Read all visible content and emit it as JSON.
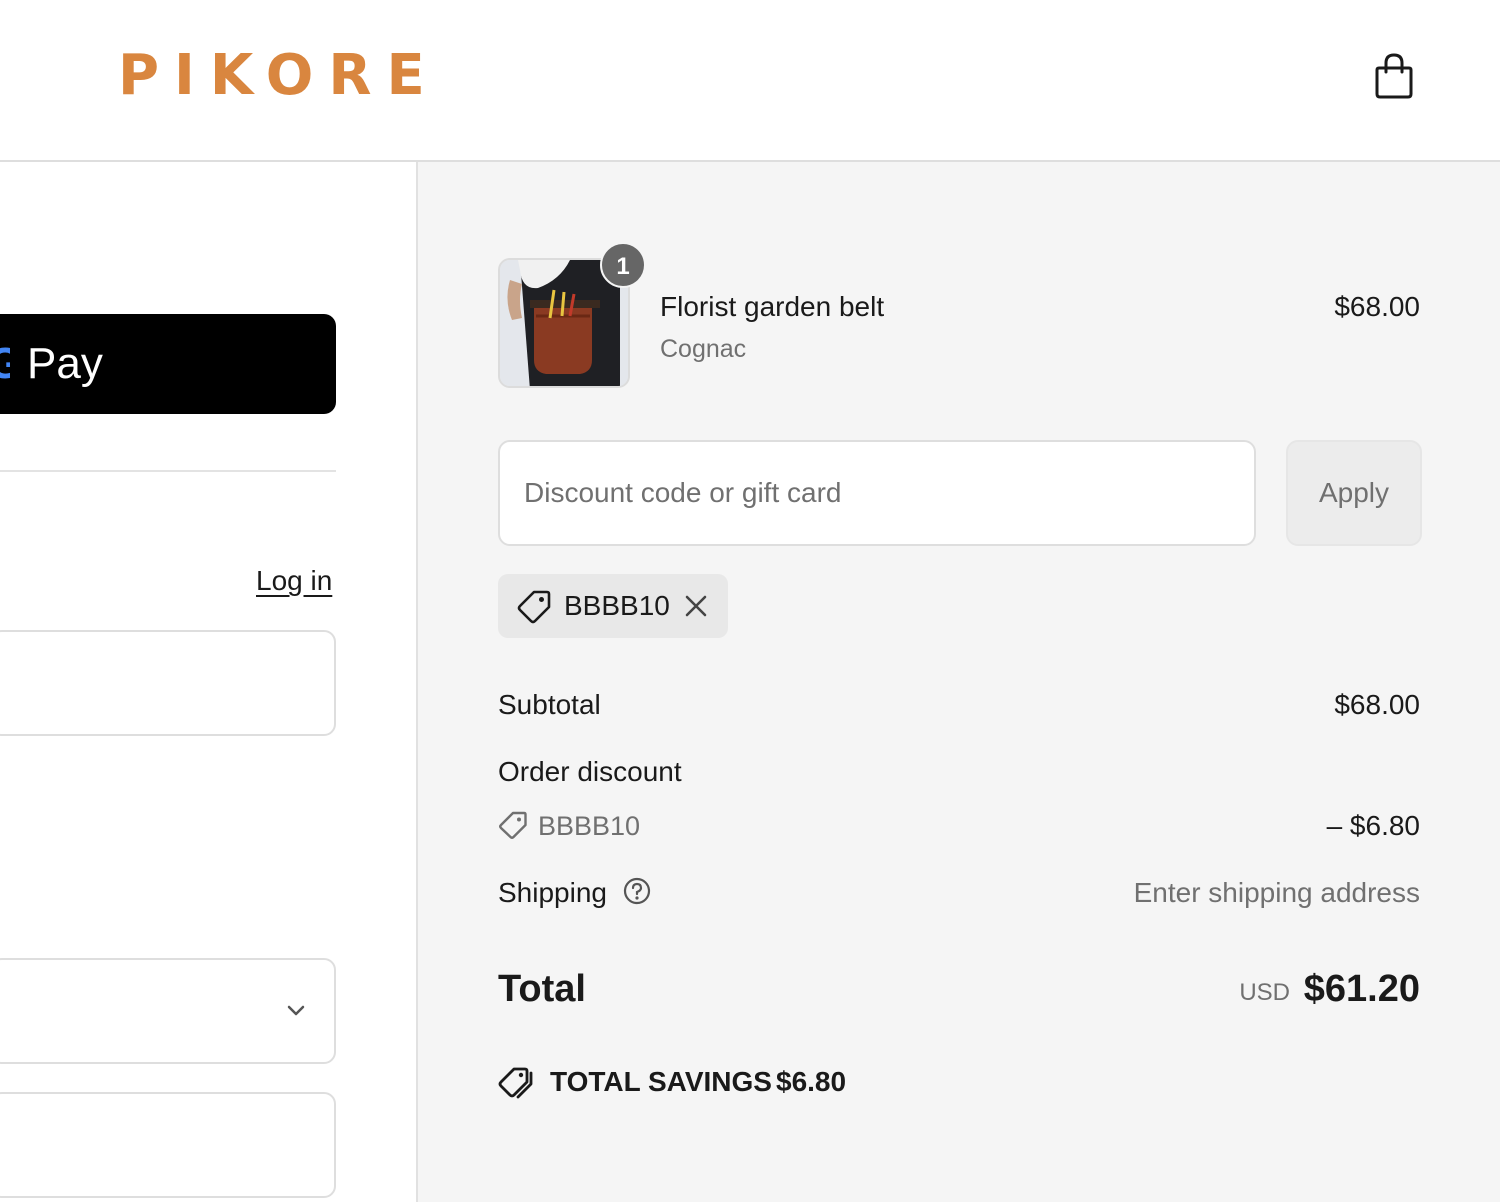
{
  "header": {
    "brand": "PIKORE",
    "cart_icon": "shopping-bag-icon"
  },
  "left": {
    "express_pay": {
      "label": "Pay",
      "icon": "google-g-icon"
    },
    "login_link": "Log in",
    "select_icon": "chevron-down-icon"
  },
  "order_summary": {
    "item": {
      "name": "Florist garden belt",
      "variant": "Cognac",
      "price": "$68.00",
      "quantity": "1"
    },
    "discount": {
      "placeholder": "Discount code or gift card",
      "apply_label": "Apply",
      "applied_code": "BBBB10"
    },
    "subtotal_label": "Subtotal",
    "subtotal_value": "$68.00",
    "order_discount_label": "Order discount",
    "order_discount_code": "BBBB10",
    "order_discount_value": "– $6.80",
    "shipping_label": "Shipping",
    "shipping_value": "Enter shipping address",
    "total_label": "Total",
    "total_currency": "USD",
    "total_value": "$61.20",
    "savings_label": "TOTAL SAVINGS",
    "savings_value": "$6.80"
  },
  "colors": {
    "brand": "#d9863f",
    "panel_bg": "#f5f5f5",
    "muted_text": "#707070"
  }
}
